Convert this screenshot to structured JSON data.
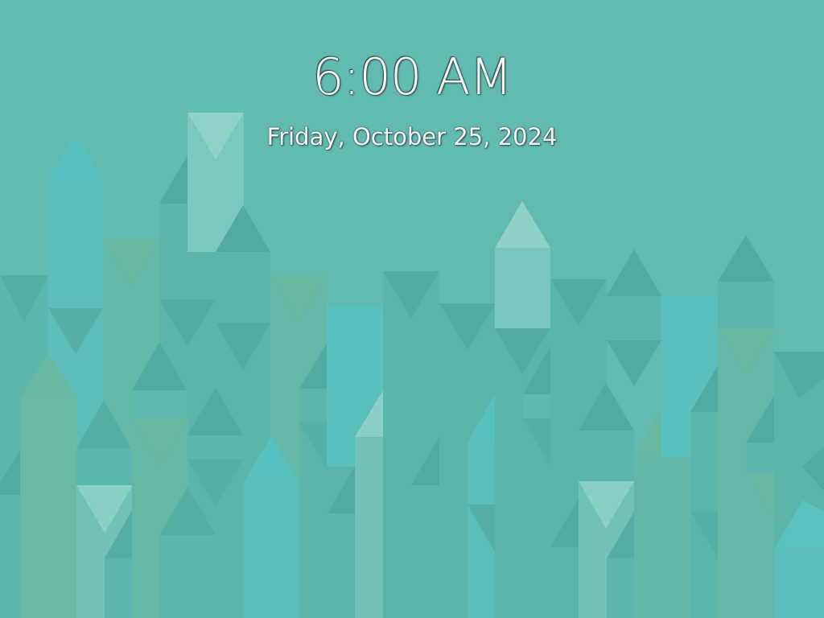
{
  "lockscreen": {
    "time": "6:00 AM",
    "date": "Friday, October 25, 2024"
  },
  "theme": {
    "background": "#62bbb1",
    "text": "#f4f6f5"
  }
}
